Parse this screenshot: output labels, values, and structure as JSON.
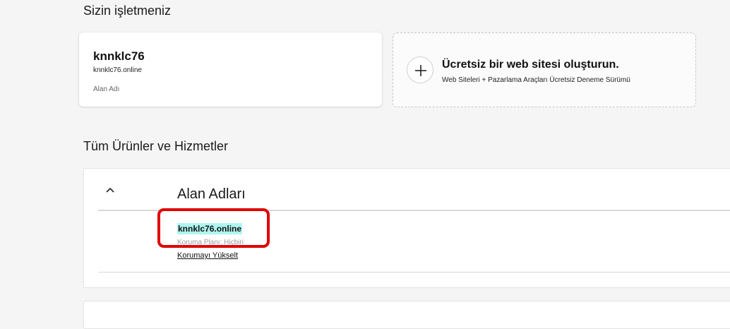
{
  "business_section": {
    "title": "Sizin işletmeniz",
    "domain_card": {
      "name": "knnklc76",
      "domain": "knnklc76.online",
      "type": "Alan Adı"
    },
    "website_card": {
      "icon": "plus-icon",
      "title": "Ücretsiz bir web sitesi oluşturun.",
      "description": "Web Siteleri + Pazarlama Araçları Ücretsiz Deneme Sürümü"
    }
  },
  "products_section": {
    "title": "Tüm Ürünler ve Hizmetler",
    "group": {
      "toggle_icon": "chevron-up-icon",
      "title": "Alan Adları",
      "items": [
        {
          "domain": "knnklc76.online",
          "protection": "Koruma Planı: Hiçbiri",
          "upgrade_label": "Korumayı Yükselt"
        }
      ]
    }
  },
  "annotation": {
    "highlight_color": "#e00000",
    "domain_highlight_color": "#aef6f0"
  }
}
